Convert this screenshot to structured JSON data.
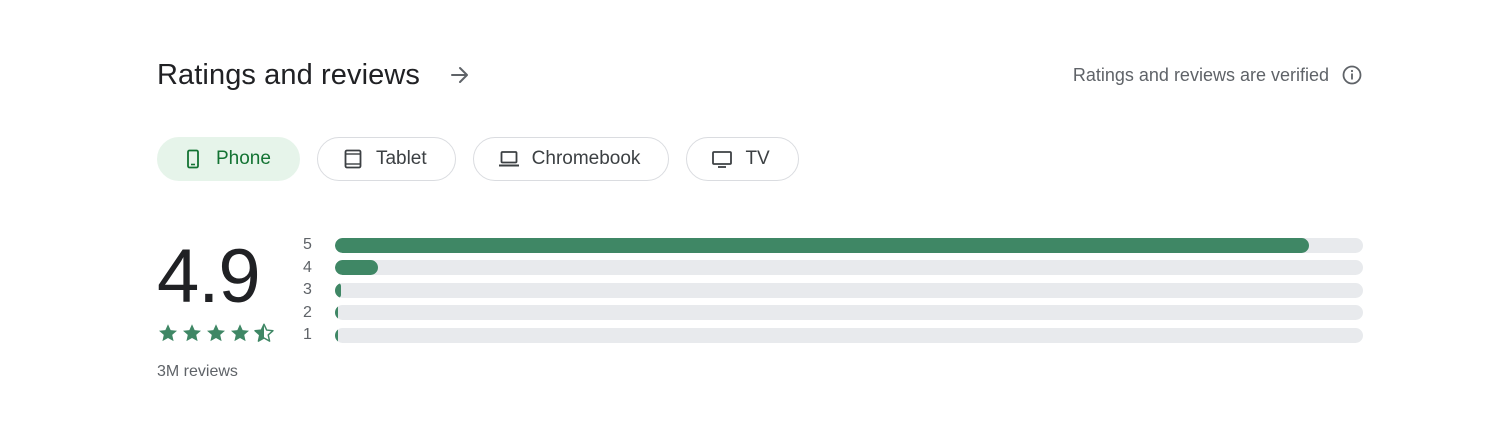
{
  "header": {
    "title": "Ratings and reviews",
    "arrow_icon": "arrow-right-icon",
    "verified_text": "Ratings and reviews are verified",
    "info_icon": "info-icon"
  },
  "device_tabs": [
    {
      "label": "Phone",
      "icon": "phone-icon",
      "selected": true
    },
    {
      "label": "Tablet",
      "icon": "tablet-icon",
      "selected": false
    },
    {
      "label": "Chromebook",
      "icon": "laptop-icon",
      "selected": false
    },
    {
      "label": "TV",
      "icon": "tv-icon",
      "selected": false
    }
  ],
  "summary": {
    "score": "4.9",
    "stars": 4.9,
    "reviews": "3M reviews"
  },
  "distribution": [
    {
      "label": "5",
      "fraction": 0.947
    },
    {
      "label": "4",
      "fraction": 0.042
    },
    {
      "label": "3",
      "fraction": 0.006
    },
    {
      "label": "2",
      "fraction": 0.002
    },
    {
      "label": "1",
      "fraction": 0.002
    }
  ],
  "colors": {
    "accent": "#3f8765",
    "chip_selected_bg": "#e6f4ea",
    "chip_selected_text": "#137333",
    "track": "#e8eaed",
    "secondary_text": "#5f6368"
  }
}
